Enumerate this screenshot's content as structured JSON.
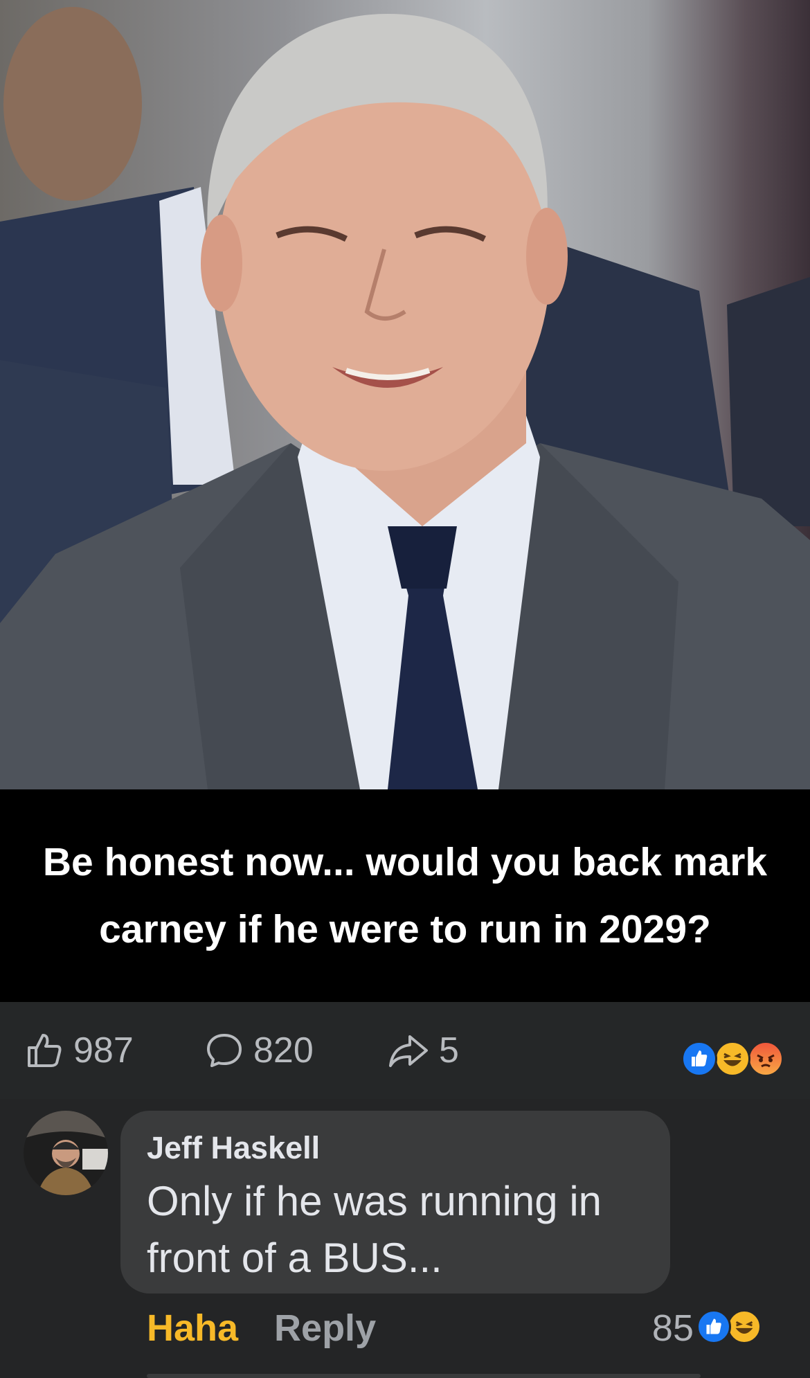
{
  "post": {
    "caption": "Be honest now... would you back mark carney if he were to run in 2029?",
    "likes_count": "987",
    "comments_count": "820",
    "shares_count": "5",
    "reaction_icons": [
      "like-icon",
      "haha-icon",
      "angry-icon"
    ]
  },
  "comment": {
    "author": "Jeff Haskell",
    "text": "Only if he was running in front of a BUS...",
    "haha_label": "Haha",
    "reply_label": "Reply",
    "reaction_count": "85",
    "reaction_icons": [
      "like-icon",
      "haha-icon"
    ]
  },
  "colors": {
    "background": "#242526",
    "bubble": "#3a3b3c",
    "like_blue": "#1877f2",
    "haha_yellow": "#f7b928",
    "caption_bg": "#000000"
  }
}
